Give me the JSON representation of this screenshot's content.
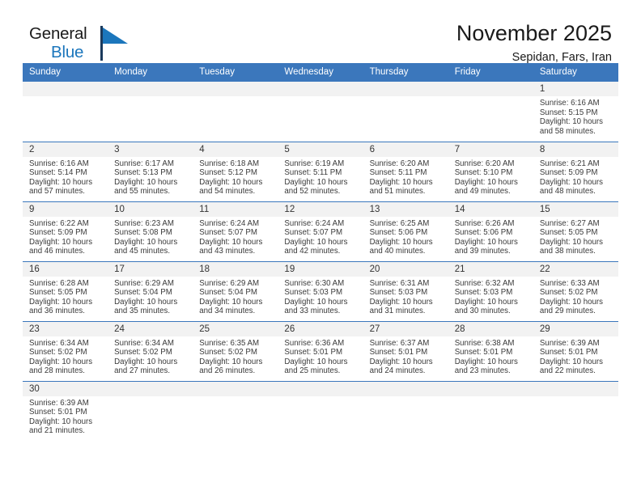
{
  "brand": {
    "name_part1": "General",
    "name_part2": "Blue",
    "flag_color": "#1b76bc",
    "bar_color": "#1b3a5c"
  },
  "header": {
    "title": "November 2025",
    "subtitle": "Sepidan, Fars, Iran"
  },
  "theme": {
    "header_bar": "#3b77bc",
    "daynum_band": "#f2f2f2",
    "row_divider": "#3b77bc",
    "text": "#3a3a3a"
  },
  "weekday_headers": [
    "Sunday",
    "Monday",
    "Tuesday",
    "Wednesday",
    "Thursday",
    "Friday",
    "Saturday"
  ],
  "weeks": [
    [
      {
        "day": "",
        "empty": true
      },
      {
        "day": "",
        "empty": true
      },
      {
        "day": "",
        "empty": true
      },
      {
        "day": "",
        "empty": true
      },
      {
        "day": "",
        "empty": true
      },
      {
        "day": "",
        "empty": true
      },
      {
        "day": "1",
        "sunrise": "Sunrise: 6:16 AM",
        "sunset": "Sunset: 5:15 PM",
        "daylight_l1": "Daylight: 10 hours",
        "daylight_l2": "and 58 minutes."
      }
    ],
    [
      {
        "day": "2",
        "sunrise": "Sunrise: 6:16 AM",
        "sunset": "Sunset: 5:14 PM",
        "daylight_l1": "Daylight: 10 hours",
        "daylight_l2": "and 57 minutes."
      },
      {
        "day": "3",
        "sunrise": "Sunrise: 6:17 AM",
        "sunset": "Sunset: 5:13 PM",
        "daylight_l1": "Daylight: 10 hours",
        "daylight_l2": "and 55 minutes."
      },
      {
        "day": "4",
        "sunrise": "Sunrise: 6:18 AM",
        "sunset": "Sunset: 5:12 PM",
        "daylight_l1": "Daylight: 10 hours",
        "daylight_l2": "and 54 minutes."
      },
      {
        "day": "5",
        "sunrise": "Sunrise: 6:19 AM",
        "sunset": "Sunset: 5:11 PM",
        "daylight_l1": "Daylight: 10 hours",
        "daylight_l2": "and 52 minutes."
      },
      {
        "day": "6",
        "sunrise": "Sunrise: 6:20 AM",
        "sunset": "Sunset: 5:11 PM",
        "daylight_l1": "Daylight: 10 hours",
        "daylight_l2": "and 51 minutes."
      },
      {
        "day": "7",
        "sunrise": "Sunrise: 6:20 AM",
        "sunset": "Sunset: 5:10 PM",
        "daylight_l1": "Daylight: 10 hours",
        "daylight_l2": "and 49 minutes."
      },
      {
        "day": "8",
        "sunrise": "Sunrise: 6:21 AM",
        "sunset": "Sunset: 5:09 PM",
        "daylight_l1": "Daylight: 10 hours",
        "daylight_l2": "and 48 minutes."
      }
    ],
    [
      {
        "day": "9",
        "sunrise": "Sunrise: 6:22 AM",
        "sunset": "Sunset: 5:09 PM",
        "daylight_l1": "Daylight: 10 hours",
        "daylight_l2": "and 46 minutes."
      },
      {
        "day": "10",
        "sunrise": "Sunrise: 6:23 AM",
        "sunset": "Sunset: 5:08 PM",
        "daylight_l1": "Daylight: 10 hours",
        "daylight_l2": "and 45 minutes."
      },
      {
        "day": "11",
        "sunrise": "Sunrise: 6:24 AM",
        "sunset": "Sunset: 5:07 PM",
        "daylight_l1": "Daylight: 10 hours",
        "daylight_l2": "and 43 minutes."
      },
      {
        "day": "12",
        "sunrise": "Sunrise: 6:24 AM",
        "sunset": "Sunset: 5:07 PM",
        "daylight_l1": "Daylight: 10 hours",
        "daylight_l2": "and 42 minutes."
      },
      {
        "day": "13",
        "sunrise": "Sunrise: 6:25 AM",
        "sunset": "Sunset: 5:06 PM",
        "daylight_l1": "Daylight: 10 hours",
        "daylight_l2": "and 40 minutes."
      },
      {
        "day": "14",
        "sunrise": "Sunrise: 6:26 AM",
        "sunset": "Sunset: 5:06 PM",
        "daylight_l1": "Daylight: 10 hours",
        "daylight_l2": "and 39 minutes."
      },
      {
        "day": "15",
        "sunrise": "Sunrise: 6:27 AM",
        "sunset": "Sunset: 5:05 PM",
        "daylight_l1": "Daylight: 10 hours",
        "daylight_l2": "and 38 minutes."
      }
    ],
    [
      {
        "day": "16",
        "sunrise": "Sunrise: 6:28 AM",
        "sunset": "Sunset: 5:05 PM",
        "daylight_l1": "Daylight: 10 hours",
        "daylight_l2": "and 36 minutes."
      },
      {
        "day": "17",
        "sunrise": "Sunrise: 6:29 AM",
        "sunset": "Sunset: 5:04 PM",
        "daylight_l1": "Daylight: 10 hours",
        "daylight_l2": "and 35 minutes."
      },
      {
        "day": "18",
        "sunrise": "Sunrise: 6:29 AM",
        "sunset": "Sunset: 5:04 PM",
        "daylight_l1": "Daylight: 10 hours",
        "daylight_l2": "and 34 minutes."
      },
      {
        "day": "19",
        "sunrise": "Sunrise: 6:30 AM",
        "sunset": "Sunset: 5:03 PM",
        "daylight_l1": "Daylight: 10 hours",
        "daylight_l2": "and 33 minutes."
      },
      {
        "day": "20",
        "sunrise": "Sunrise: 6:31 AM",
        "sunset": "Sunset: 5:03 PM",
        "daylight_l1": "Daylight: 10 hours",
        "daylight_l2": "and 31 minutes."
      },
      {
        "day": "21",
        "sunrise": "Sunrise: 6:32 AM",
        "sunset": "Sunset: 5:03 PM",
        "daylight_l1": "Daylight: 10 hours",
        "daylight_l2": "and 30 minutes."
      },
      {
        "day": "22",
        "sunrise": "Sunrise: 6:33 AM",
        "sunset": "Sunset: 5:02 PM",
        "daylight_l1": "Daylight: 10 hours",
        "daylight_l2": "and 29 minutes."
      }
    ],
    [
      {
        "day": "23",
        "sunrise": "Sunrise: 6:34 AM",
        "sunset": "Sunset: 5:02 PM",
        "daylight_l1": "Daylight: 10 hours",
        "daylight_l2": "and 28 minutes."
      },
      {
        "day": "24",
        "sunrise": "Sunrise: 6:34 AM",
        "sunset": "Sunset: 5:02 PM",
        "daylight_l1": "Daylight: 10 hours",
        "daylight_l2": "and 27 minutes."
      },
      {
        "day": "25",
        "sunrise": "Sunrise: 6:35 AM",
        "sunset": "Sunset: 5:02 PM",
        "daylight_l1": "Daylight: 10 hours",
        "daylight_l2": "and 26 minutes."
      },
      {
        "day": "26",
        "sunrise": "Sunrise: 6:36 AM",
        "sunset": "Sunset: 5:01 PM",
        "daylight_l1": "Daylight: 10 hours",
        "daylight_l2": "and 25 minutes."
      },
      {
        "day": "27",
        "sunrise": "Sunrise: 6:37 AM",
        "sunset": "Sunset: 5:01 PM",
        "daylight_l1": "Daylight: 10 hours",
        "daylight_l2": "and 24 minutes."
      },
      {
        "day": "28",
        "sunrise": "Sunrise: 6:38 AM",
        "sunset": "Sunset: 5:01 PM",
        "daylight_l1": "Daylight: 10 hours",
        "daylight_l2": "and 23 minutes."
      },
      {
        "day": "29",
        "sunrise": "Sunrise: 6:39 AM",
        "sunset": "Sunset: 5:01 PM",
        "daylight_l1": "Daylight: 10 hours",
        "daylight_l2": "and 22 minutes."
      }
    ],
    [
      {
        "day": "30",
        "sunrise": "Sunrise: 6:39 AM",
        "sunset": "Sunset: 5:01 PM",
        "daylight_l1": "Daylight: 10 hours",
        "daylight_l2": "and 21 minutes."
      },
      {
        "day": "",
        "empty": true
      },
      {
        "day": "",
        "empty": true
      },
      {
        "day": "",
        "empty": true
      },
      {
        "day": "",
        "empty": true
      },
      {
        "day": "",
        "empty": true
      },
      {
        "day": "",
        "empty": true
      }
    ]
  ]
}
